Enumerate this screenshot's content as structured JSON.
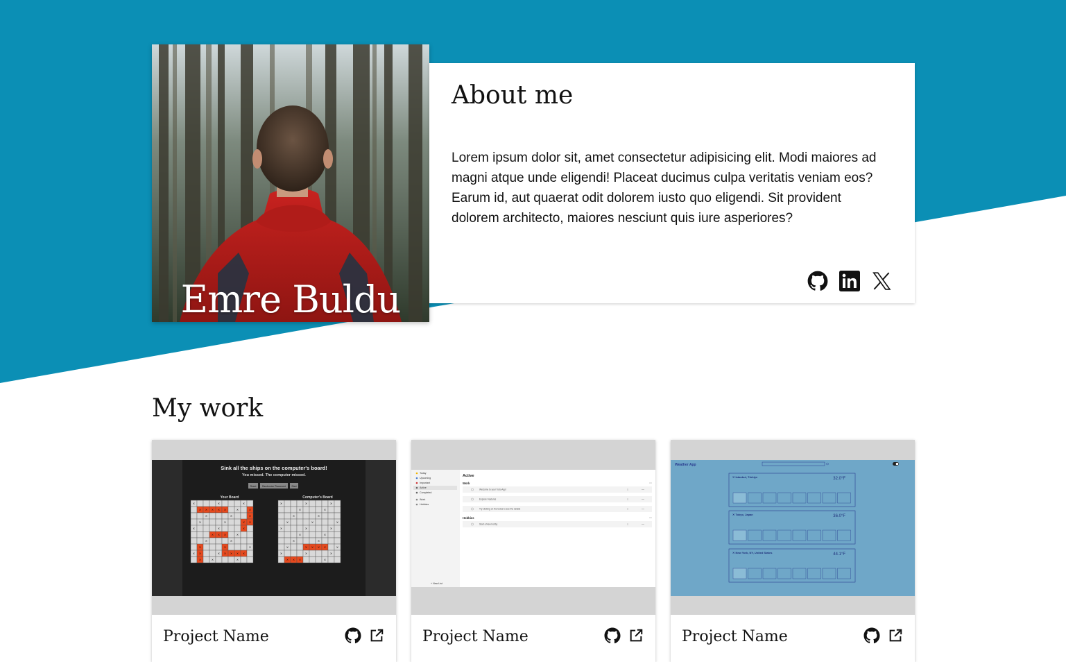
{
  "colors": {
    "accent": "#0b8fb5",
    "text": "#111111",
    "ship": "#e8491d",
    "weather_bg": "#6fa7c8"
  },
  "profile": {
    "name": "Emre Buldu",
    "photo": "person-in-red-jacket-forest"
  },
  "about": {
    "title": "About me",
    "text": "Lorem ipsum dolor sit, amet consectetur adipisicing elit. Modi maiores ad magni atque unde eligendi! Placeat ducimus culpa veritatis veniam eos? Earum id, aut quaerat odit dolorem iusto quo eligendi. Sit provident dolorem architecto, maiores nesciunt quis iure asperiores?",
    "socials": [
      {
        "name": "GitHub",
        "icon": "github-icon"
      },
      {
        "name": "LinkedIn",
        "icon": "linkedin-icon"
      },
      {
        "name": "X",
        "icon": "x-icon"
      }
    ]
  },
  "work": {
    "title": "My work",
    "projects": [
      {
        "name": "Project Name",
        "thumbnail": "battleship",
        "screenshot": {
          "heading": "Sink all the ships on the computer's board!",
          "status": "You missed. The computer missed.",
          "buttons": [
            "Reset",
            "Randomize Placement",
            "Start"
          ],
          "board_left": "Your Board",
          "board_right": "Computer's Board"
        }
      },
      {
        "name": "Project Name",
        "thumbnail": "todo-app",
        "screenshot": {
          "sidebar": [
            "Today",
            "Upcoming",
            "Important",
            "Active",
            "Completed",
            "Work",
            "Hobbies"
          ],
          "add_list": "+ New List",
          "section": "Active",
          "groups": [
            {
              "name": "Work",
              "tasks": [
                "Welcome to your Todo App!",
                "Explore Features",
                "Try clicking on the todos to see the details"
              ]
            },
            {
              "name": "Hobbies",
              "tasks": [
                "Start a New hobby"
              ]
            }
          ]
        }
      },
      {
        "name": "Project Name",
        "thumbnail": "weather-app",
        "screenshot": {
          "app_title": "Weather App",
          "cities": [
            {
              "name": "Istanbul, Türkiye",
              "temp": "32.0°F"
            },
            {
              "name": "Tokyo, Japan",
              "temp": "36.0°F"
            },
            {
              "name": "New York, NY, United States",
              "temp": "44.1°F"
            }
          ]
        }
      }
    ]
  }
}
